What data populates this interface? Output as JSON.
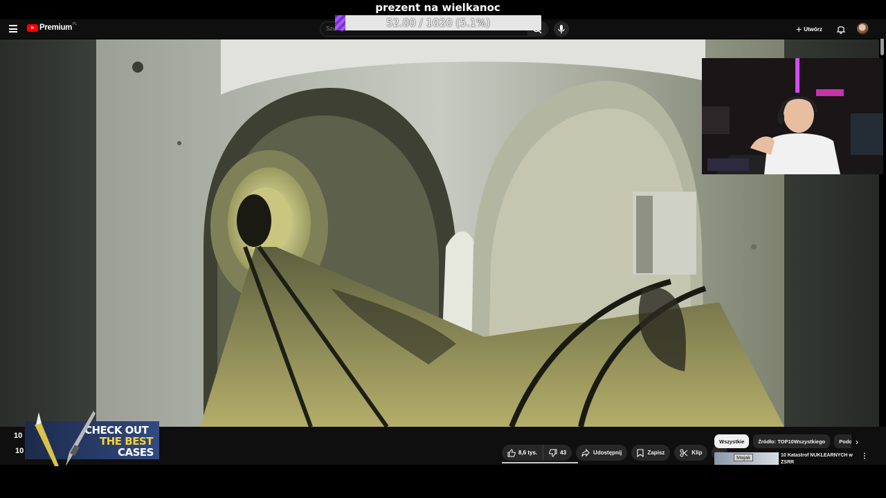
{
  "overlay": {
    "donation_title": "prezent na wielkanoc",
    "goal_text": "52.00 / 1020 (5.1%)",
    "goal_fraction": 0.051,
    "goal_fill_color": "#8a3fe0"
  },
  "header": {
    "brand": "Premium",
    "region": "PL",
    "search_placeholder": "Szukaj",
    "create_label": "Utwórz",
    "icons": [
      "menu-icon",
      "youtube-logo-icon",
      "search-icon",
      "mic-icon",
      "plus-icon",
      "bell-icon",
      "avatar"
    ]
  },
  "video": {
    "scene": "underground-railway-tunnel"
  },
  "promo": {
    "line1": "CHECK OUT",
    "line2": "THE BEST",
    "line3": "CASES"
  },
  "channel": {
    "subscriber_prefix_top": "10",
    "subscriber_prefix_bottom": "10"
  },
  "actions": {
    "like_count": "8,6 tys.",
    "dislike_count": "43",
    "share_label": "Udostępnij",
    "save_label": "Zapisz",
    "clip_label": "Klip",
    "more_label": "⋯"
  },
  "recommendations": {
    "chips": [
      "Wszystkie",
      "Źródło: TOP10Wszystkiego",
      "Podobne"
    ],
    "active_chip": 0,
    "first_item": {
      "badge": "Majak",
      "title": "10 Katastrof NUKLEARNYCH w ZSRR"
    }
  },
  "colors": {
    "youtube_red": "#ff0000",
    "header_bg": "#0f0f0f",
    "promo_yellow": "#f7d33a"
  }
}
